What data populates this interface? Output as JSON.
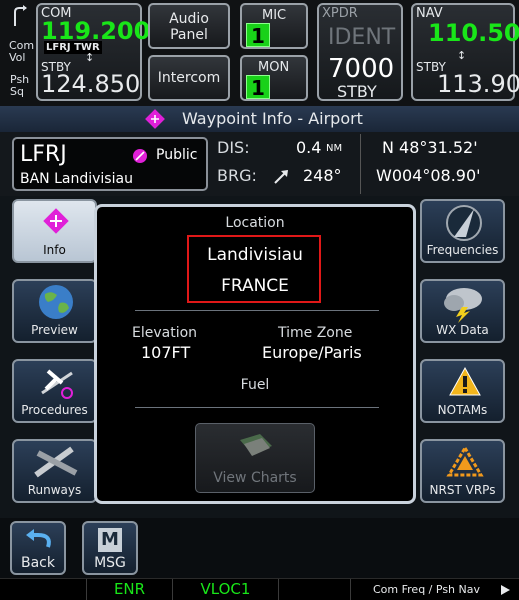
{
  "top": {
    "com_vol": [
      "Com",
      "Vol"
    ],
    "psh_sq": [
      "Psh",
      "Sq"
    ],
    "com_label": "COM",
    "com_active": "119.200",
    "com_station": "LFRJ TWR",
    "com_stby_label": "STBY",
    "com_stby": "124.850",
    "audio_panel": [
      "Audio",
      "Panel"
    ],
    "intercom": "Intercom",
    "mic_label": "MIC",
    "mic_value": "1",
    "mon_label": "MON",
    "mon_value": "1",
    "xpdr_label": "XPDR",
    "ident": "IDENT",
    "squawk": "7000",
    "xpdr_mode": "STBY",
    "nav_label": "NAV",
    "nav_active": "110.50",
    "nav_stby_label": "STBY",
    "nav_stby": "113.90"
  },
  "title": "Waypoint Info - Airport",
  "waypoint": {
    "ident": "LFRJ",
    "type": "Public",
    "name": "BAN Landivisiau",
    "dis_label": "DIS:",
    "dis_value": "0.4",
    "dis_unit": "NM",
    "brg_label": "BRG:",
    "brg_value": "248°",
    "lat": "N 48°31.52'",
    "lon": "W004°08.90'"
  },
  "left_buttons": [
    {
      "label": "Info",
      "icon": "waypoint-diamond-icon",
      "active": true
    },
    {
      "label": "Preview",
      "icon": "globe-icon",
      "active": false
    },
    {
      "label": "Procedures",
      "icon": "airplane-approach-icon",
      "active": false
    },
    {
      "label": "Runways",
      "icon": "runways-icon",
      "active": false
    }
  ],
  "right_buttons": [
    {
      "label": "Frequencies",
      "icon": "antenna-icon"
    },
    {
      "label": "WX Data",
      "icon": "storm-cloud-icon"
    },
    {
      "label": "NOTAMs",
      "icon": "warning-triangle-icon"
    },
    {
      "label": "NRST VRPs",
      "icon": "vrp-triangle-icon"
    }
  ],
  "popup": {
    "location_label": "Location",
    "city": "Landivisiau",
    "country": "FRANCE",
    "elevation_label": "Elevation",
    "elevation_value": "107FT",
    "timezone_label": "Time Zone",
    "timezone_value": "Europe/Paris",
    "fuel_label": "Fuel",
    "view_charts": "View Charts"
  },
  "bottom": {
    "back": "Back",
    "msg_icon_letter": "M",
    "msg": "MSG"
  },
  "status": {
    "enr": "ENR",
    "vloc": "VLOC1",
    "hint": "Com Freq / Psh Nav"
  },
  "colors": {
    "accent_green": "#19e619",
    "title_magenta": "#e020d8",
    "highlight_red": "#e01818"
  }
}
